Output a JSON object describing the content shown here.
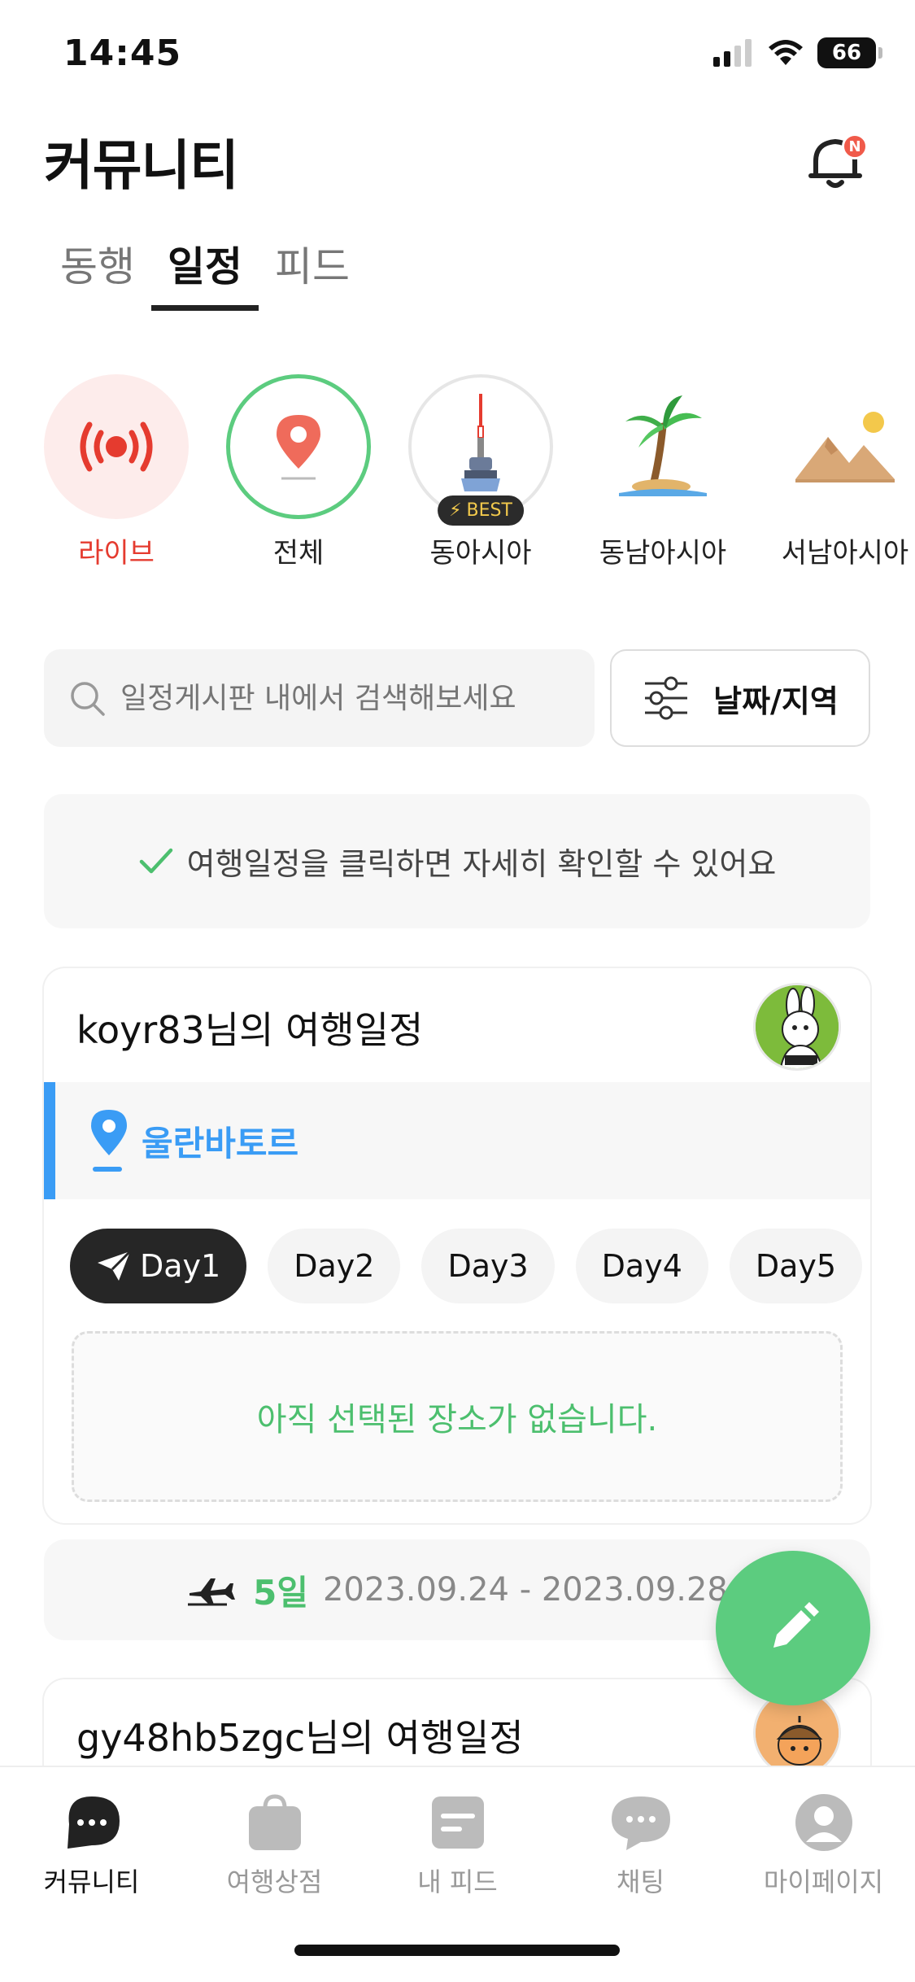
{
  "status": {
    "time": "14:45",
    "battery": "66"
  },
  "header": {
    "title": "커뮤니티",
    "bell_badge": "N"
  },
  "tabs": [
    {
      "label": "동행",
      "active": false
    },
    {
      "label": "일정",
      "active": true
    },
    {
      "label": "피드",
      "active": false
    }
  ],
  "categories": [
    {
      "label": "라이브",
      "icon": "live-broadcast-icon"
    },
    {
      "label": "전체",
      "icon": "map-pin-icon"
    },
    {
      "label": "동아시아",
      "icon": "tower-icon",
      "badge": "BEST"
    },
    {
      "label": "동남아시아",
      "icon": "palm-tree-icon"
    },
    {
      "label": "서남아시아",
      "icon": "desert-mountain-icon"
    }
  ],
  "search": {
    "placeholder": "일정게시판 내에서 검색해보세요"
  },
  "filter": {
    "label": "날짜/지역"
  },
  "info": {
    "text": "여행일정을 클릭하면 자세히 확인할 수 있어요"
  },
  "trip": {
    "title": "koyr83님의 여행일정",
    "location": "울란바토르",
    "days": [
      "Day1",
      "Day2",
      "Day3",
      "Day4",
      "Day5"
    ],
    "empty_text": "아직 선택된 장소가 없습니다.",
    "duration_days": "5일",
    "date_range": "2023.09.24 - 2023.09.28"
  },
  "trip2": {
    "title": "gy48hb5zgc님의 여행일정"
  },
  "bottom_nav": [
    {
      "label": "커뮤니티",
      "active": true
    },
    {
      "label": "여행상점",
      "active": false
    },
    {
      "label": "내 피드",
      "active": false
    },
    {
      "label": "채팅",
      "active": false
    },
    {
      "label": "마이페이지",
      "active": false
    }
  ],
  "colors": {
    "accent_green": "#5ccc7f",
    "live_red": "#e53b2f",
    "location_blue": "#3a9cf5"
  }
}
